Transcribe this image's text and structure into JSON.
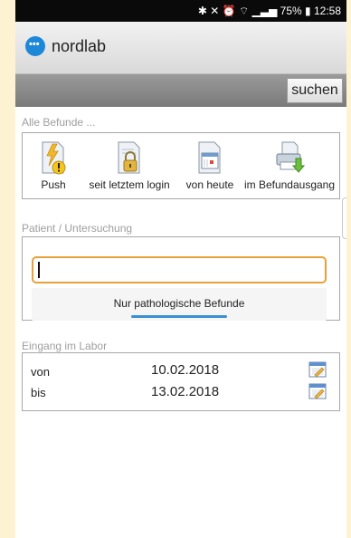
{
  "status_bar": {
    "battery": "75%",
    "time": "12:58"
  },
  "app": {
    "title": "nordlab",
    "logo_icon": "nordlab-logo-icon"
  },
  "toolbar": {
    "search_label": "suchen"
  },
  "befunde": {
    "section_label": "Alle Befunde ...",
    "categories": [
      {
        "label": "Push",
        "icon": "push-document-icon"
      },
      {
        "label": "seit letztem login",
        "icon": "locked-document-icon"
      },
      {
        "label": "von heute",
        "icon": "calendar-document-icon"
      },
      {
        "label": "im Befundausgang",
        "icon": "printer-outbox-icon"
      }
    ]
  },
  "patient": {
    "section_label": "Patient / Untersuchung",
    "input_value": "",
    "toggle_label": "Nur pathologische Befunde"
  },
  "eingang": {
    "section_label": "Eingang im Labor",
    "von_label": "von",
    "von_value": "10.02.2018",
    "bis_label": "bis",
    "bis_value": "13.02.2018"
  },
  "colors": {
    "accent": "#1e88d8",
    "input_focus": "#e6a13b",
    "background": "#fdf3d3"
  }
}
